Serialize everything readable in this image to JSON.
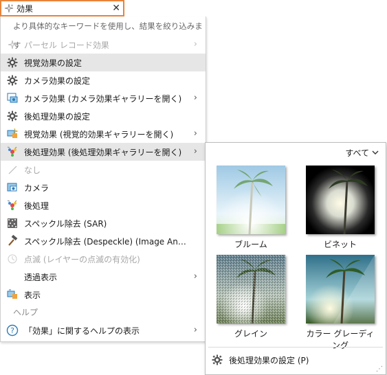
{
  "search": {
    "value": "効果",
    "clear_symbol": "✕"
  },
  "menu": {
    "hint": "より具体的なキーワードを使用し、結果を絞り込みます",
    "items": [
      {
        "label": "パーセル レコード効果",
        "icon": "sparkle-icon",
        "disabled": true,
        "submenu": true
      },
      {
        "label": "視覚効果の設定",
        "icon": "gear-icon",
        "hover": true
      },
      {
        "label": "カメラ効果の設定",
        "icon": "gear-icon"
      },
      {
        "label": "カメラ効果 (カメラ効果ギャラリーを開く)",
        "icon": "camera-gallery-icon",
        "submenu": true
      },
      {
        "label": "後処理効果の設定",
        "icon": "gear-icon"
      },
      {
        "label": "視覚効果 (視覚的効果ギャラリーを開く)",
        "icon": "visual-effects-icon",
        "submenu": true
      },
      {
        "label": "後処理効果 (後処理効果ギャラリーを開く)",
        "icon": "post-processing-icon",
        "submenu": true,
        "hover": true
      },
      {
        "label": "なし",
        "icon": "none-slash-icon",
        "disabled": true
      },
      {
        "label": "カメラ",
        "icon": "camera-icon"
      },
      {
        "label": "後処理",
        "icon": "post-processing-icon"
      },
      {
        "label": "スペックル除去 (SAR)",
        "icon": "speckle-icon"
      },
      {
        "label": "スペックル除去 (Despeckle) (Image Analyst...",
        "icon": "hammer-icon"
      },
      {
        "label": "点滅 (レイヤーの点滅の有効化)",
        "icon": "blink-icon",
        "disabled": true
      },
      {
        "label": "透過表示",
        "icon": "",
        "submenu": true
      },
      {
        "label": "表示",
        "icon": "display-icon"
      }
    ],
    "help_section": "ヘルプ",
    "help_item": {
      "label": "「効果」に関するヘルプの表示",
      "icon": "help-icon",
      "submenu": true
    }
  },
  "gallery": {
    "filter_label": "すべて",
    "thumbnails": [
      {
        "caption": "ブルーム",
        "style": "bloom"
      },
      {
        "caption": "ビネット",
        "style": "vignette"
      },
      {
        "caption": "グレイン",
        "style": "grain"
      },
      {
        "caption": "カラー グレーディング",
        "style": "grading"
      }
    ],
    "command": {
      "label": "後処理効果の設定 (P)",
      "icon": "gear-icon"
    }
  },
  "colors": {
    "search_border": "#e8833a",
    "hover": "#e6e6e6",
    "disabled": "#a8a8a8"
  }
}
